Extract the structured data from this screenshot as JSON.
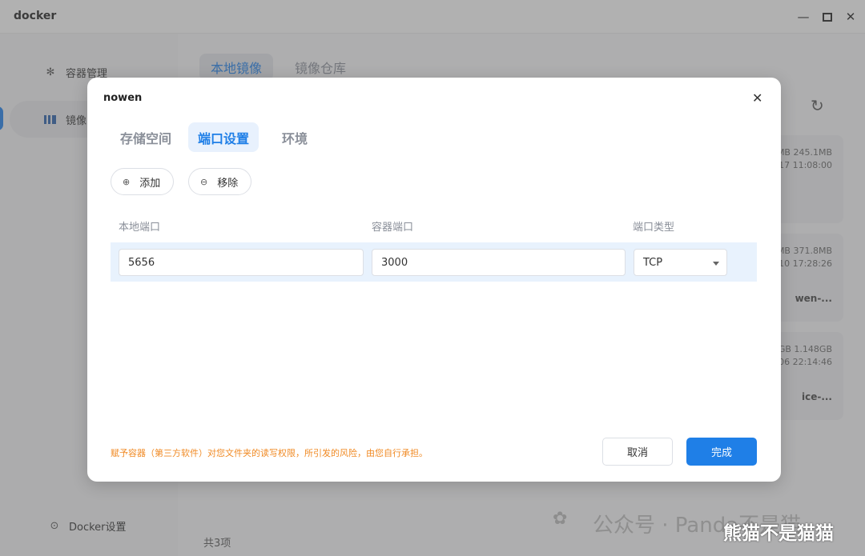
{
  "window": {
    "title": "docker",
    "min_icon": "minimize-icon",
    "max_icon": "maximize-icon",
    "close_icon": "close-icon"
  },
  "sidebar": {
    "items": [
      {
        "label": "容器管理",
        "icon": "gear-icon"
      },
      {
        "label": "镜像",
        "icon": "image-icon"
      }
    ],
    "settings": {
      "label": "Docker设置",
      "icon": "settings-icon"
    }
  },
  "main": {
    "tabs": [
      {
        "label": "本地镜像"
      },
      {
        "label": "镜像仓库"
      }
    ],
    "cards": [
      {
        "size": "MB 245.1MB",
        "date": "-17 11:08:00",
        "name": ""
      },
      {
        "size": "MB 371.8MB",
        "date": "-10 17:28:26",
        "name": "wen-..."
      },
      {
        "size": "GB 1.148GB",
        "date": "06 22:14:46",
        "name": "ice-..."
      }
    ],
    "footer_count": "共3项"
  },
  "modal": {
    "title": "nowen",
    "tabs": [
      {
        "label": "存储空间"
      },
      {
        "label": "端口设置"
      },
      {
        "label": "环境"
      }
    ],
    "add_label": "添加",
    "remove_label": "移除",
    "columns": {
      "local_port": "本地端口",
      "container_port": "容器端口",
      "port_type": "端口类型"
    },
    "row": {
      "local_port": "5656",
      "container_port": "3000",
      "port_type": "TCP"
    },
    "warning": "赋予容器（第三方软件）对您文件夹的读写权限，所引发的风险，由您自行承担。",
    "cancel_label": "取消",
    "done_label": "完成"
  },
  "watermark": {
    "text": "公众号 · Panda不是猫",
    "overlay": "熊猫不是猫猫"
  },
  "colors": {
    "accent": "#1f7fe7",
    "warning": "#f08a24"
  }
}
